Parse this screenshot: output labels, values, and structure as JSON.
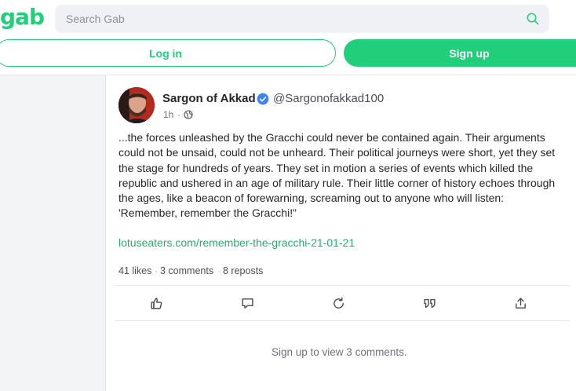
{
  "header": {
    "logo_text": "gab",
    "search_placeholder": "Search Gab",
    "login_label": "Log in",
    "signup_label": "Sign up"
  },
  "post": {
    "author_name": "Sargon of Akkad",
    "author_handle": "@Sargonofakkad100",
    "time": "1h",
    "time_separator": "·",
    "body": "...the forces unleashed by the Gracchi could never be contained again. Their arguments could not be unsaid, could not be unheard. Their political journeys were short, yet they set the stage for hundreds of years. They set in motion a series of events which killed the republic and ushered in an age of military rule. Their little corner of history echoes through the ages, like a beacon of forewarning, screaming out to anyone who will listen: 'Remember, remember the Gracchi!”",
    "link": "lotuseaters.com/remember-the-gracchi-21-01-21",
    "likes": "41 likes",
    "comments": "3 comments",
    "reposts": "8 reposts",
    "stat_separator": "·"
  },
  "actions": [
    "like-icon",
    "comment-icon",
    "repost-icon",
    "quote-icon",
    "share-icon"
  ],
  "comments_prompt": "Sign up to view 3 comments.",
  "colors": {
    "brand": "#21cf7a",
    "link": "#21b06c",
    "verified": "#3b82f6"
  }
}
